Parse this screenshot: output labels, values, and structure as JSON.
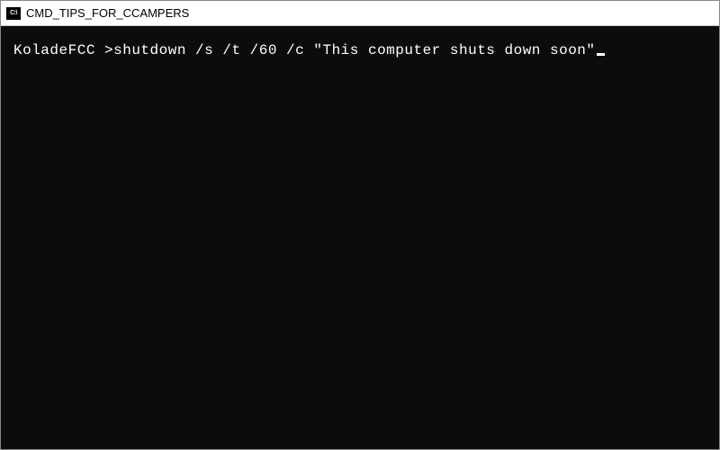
{
  "window": {
    "icon_label": "C:\\",
    "title": "CMD_TIPS_FOR_CCAMPERS"
  },
  "terminal": {
    "prompt": "KoladeFCC >",
    "command": "shutdown /s /t /60 /c \"This computer shuts down soon\""
  }
}
